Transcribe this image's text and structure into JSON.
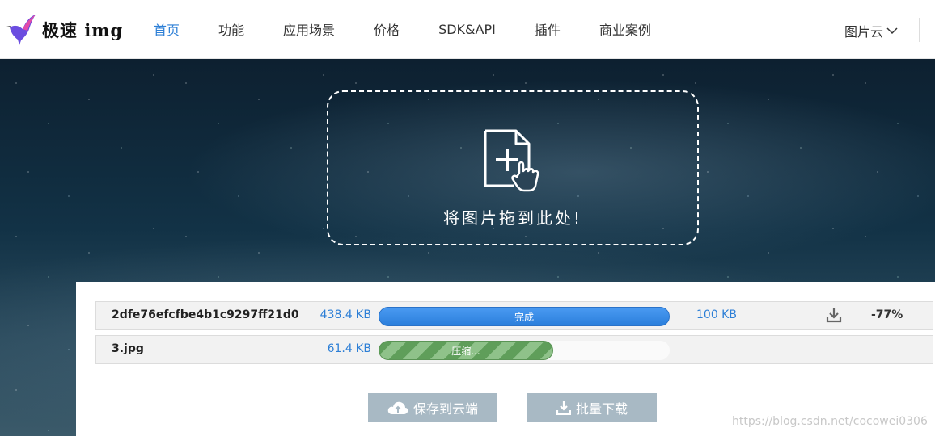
{
  "header": {
    "logo_text": "极速 img",
    "nav": [
      {
        "label": "首页",
        "active": true
      },
      {
        "label": "功能",
        "active": false
      },
      {
        "label": "应用场景",
        "active": false
      },
      {
        "label": "价格",
        "active": false
      },
      {
        "label": "SDK&API",
        "active": false
      },
      {
        "label": "插件",
        "active": false
      },
      {
        "label": "商业案例",
        "active": false
      }
    ],
    "cloud_menu_label": "图片云",
    "accent_color": "#2d7fd6"
  },
  "dropzone": {
    "text": "将图片拖到此处!"
  },
  "files": [
    {
      "name": "2dfe76efcfbe4b1c9297ff21d0...",
      "original_size": "438.4 KB",
      "status": "完成",
      "progress": 1.0,
      "output_size": "100 KB",
      "ratio": "-77%"
    },
    {
      "name": "3.jpg",
      "original_size": "61.4 KB",
      "status": "压缩...",
      "progress": 0.6
    }
  ],
  "actions": {
    "save_cloud": "保存到云端",
    "batch_download": "批量下载"
  },
  "watermark": "https://blog.csdn.net/cocowei0306"
}
